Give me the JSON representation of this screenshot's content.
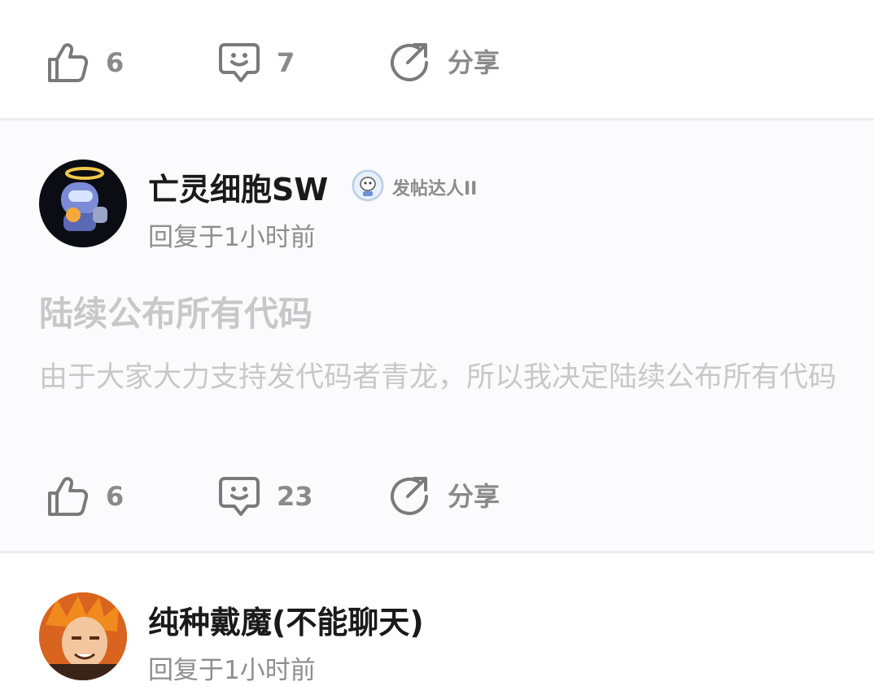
{
  "posts": [
    {
      "likes": "6",
      "comments": "7",
      "share_label": "分享"
    },
    {
      "username": "亡灵细胞SW",
      "badge": "发帖达人II",
      "reply_time": "回复于1小时前",
      "title": "陆续公布所有代码",
      "body": "由于大家大力支持发代码者青龙，所以我决定陆续公布所有代码",
      "likes": "6",
      "comments": "23",
      "share_label": "分享"
    },
    {
      "username": "纯种戴魔(不能聊天)",
      "reply_time": "回复于1小时前"
    }
  ],
  "colors": {
    "icon": "#7a7a7a",
    "count": "#8a8a8a",
    "faded_text": "#c8c8cc",
    "divider": "#ececf0"
  },
  "icons": [
    "thumbs-up-icon",
    "comment-smile-icon",
    "share-arrow-icon"
  ]
}
